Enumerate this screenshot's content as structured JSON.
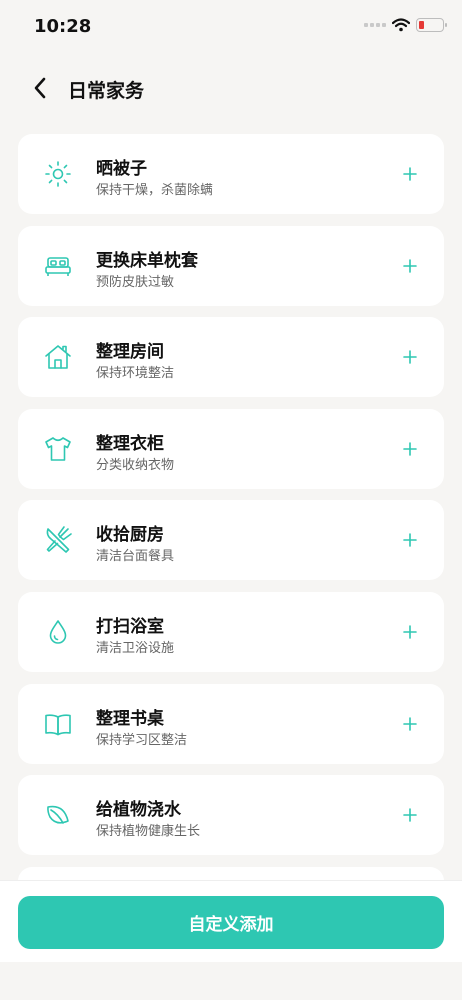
{
  "status": {
    "time": "10:28"
  },
  "header": {
    "title": "日常家务"
  },
  "items": [
    {
      "icon": "sun-icon",
      "title": "晒被子",
      "subtitle": "保持干燥，杀菌除螨"
    },
    {
      "icon": "bed-icon",
      "title": "更换床单枕套",
      "subtitle": "预防皮肤过敏"
    },
    {
      "icon": "house-icon",
      "title": "整理房间",
      "subtitle": "保持环境整洁"
    },
    {
      "icon": "tshirt-icon",
      "title": "整理衣柜",
      "subtitle": "分类收纳衣物"
    },
    {
      "icon": "utensils-icon",
      "title": "收拾厨房",
      "subtitle": "清洁台面餐具"
    },
    {
      "icon": "droplet-icon",
      "title": "打扫浴室",
      "subtitle": "清洁卫浴设施"
    },
    {
      "icon": "book-icon",
      "title": "整理书桌",
      "subtitle": "保持学习区整洁"
    },
    {
      "icon": "leaf-icon",
      "title": "给植物浇水",
      "subtitle": "保持植物健康生长"
    }
  ],
  "footer": {
    "custom_add_label": "自定义添加"
  },
  "colors": {
    "accent": "#2ec7b2",
    "battery_low": "#e53935",
    "background": "#f6f5f3"
  }
}
